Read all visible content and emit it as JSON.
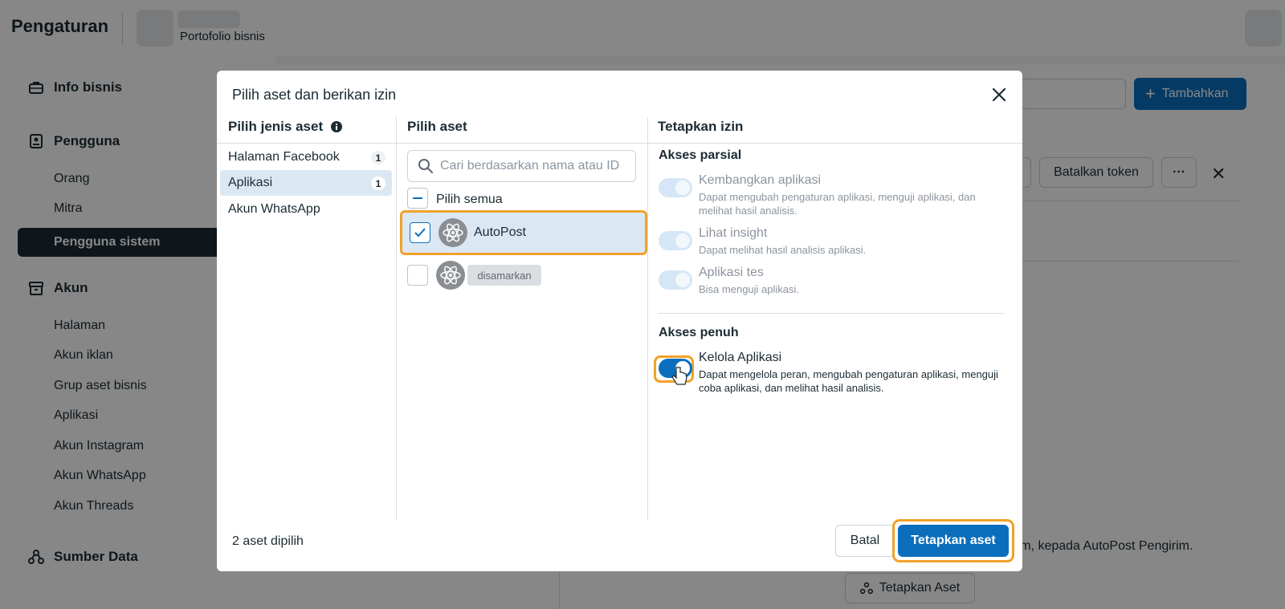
{
  "header": {
    "title": "Pengaturan",
    "portfolio_label": "Portofolio bisnis"
  },
  "sidebar": {
    "sections": [
      {
        "label": "Info bisnis",
        "icon": "briefcase-icon"
      },
      {
        "label": "Pengguna",
        "icon": "user-badge-icon"
      },
      {
        "label": "Akun",
        "icon": "archive-icon"
      },
      {
        "label": "Sumber Data",
        "icon": "data-source-icon"
      }
    ],
    "items": {
      "orang": "Orang",
      "mitra": "Mitra",
      "pengguna_sistem": "Pengguna sistem",
      "halaman": "Halaman",
      "akun_iklan": "Akun iklan",
      "grup_aset": "Grup aset bisnis",
      "aplikasi": "Aplikasi",
      "akun_instagram": "Akun Instagram",
      "akun_whatsapp": "Akun WhatsApp",
      "akun_threads": "Akun Threads"
    },
    "active_item": "Pengguna sistem"
  },
  "background": {
    "add_button": "Tambahkan",
    "revoke_token_button": "Batalkan token",
    "more_button": "···",
    "partial_text": "ram, kepada AutoPost Pengirim.",
    "assign_assets_button": "Tetapkan Aset"
  },
  "modal": {
    "title": "Pilih aset dan berikan izin",
    "col1_header": "Pilih jenis aset",
    "col2_header": "Pilih aset",
    "col3_header": "Tetapkan izin",
    "asset_types": [
      {
        "label": "Halaman Facebook",
        "count": "1"
      },
      {
        "label": "Aplikasi",
        "count": "1",
        "active": true
      },
      {
        "label": "Akun WhatsApp",
        "count": ""
      }
    ],
    "search_placeholder": "Cari berdasarkan nama atau ID",
    "select_all_label": "Pilih semua",
    "assets": [
      {
        "name": "AutoPost",
        "checked": true
      },
      {
        "name": "disamarkan",
        "checked": false
      }
    ],
    "partial_access": {
      "title": "Akses parsial",
      "items": [
        {
          "title": "Kembangkan aplikasi",
          "desc": "Dapat mengubah pengaturan aplikasi, menguji aplikasi, dan melihat hasil analisis."
        },
        {
          "title": "Lihat insight",
          "desc": "Dapat melihat hasil analisis aplikasi."
        },
        {
          "title": "Aplikasi tes",
          "desc": "Bisa menguji aplikasi."
        }
      ]
    },
    "full_access": {
      "title": "Akses penuh",
      "items": [
        {
          "title": "Kelola Aplikasi",
          "desc": "Dapat mengelola peran, mengubah pengaturan aplikasi, menguji coba aplikasi, dan melihat hasil analisis.",
          "on": true
        }
      ]
    },
    "footer_text": "2 aset dipilih",
    "cancel_button": "Batal",
    "confirm_button": "Tetapkan aset"
  },
  "colors": {
    "primary": "#0b6ebd",
    "highlight": "#f0a12a",
    "selected_bg": "#dbe8f4"
  }
}
